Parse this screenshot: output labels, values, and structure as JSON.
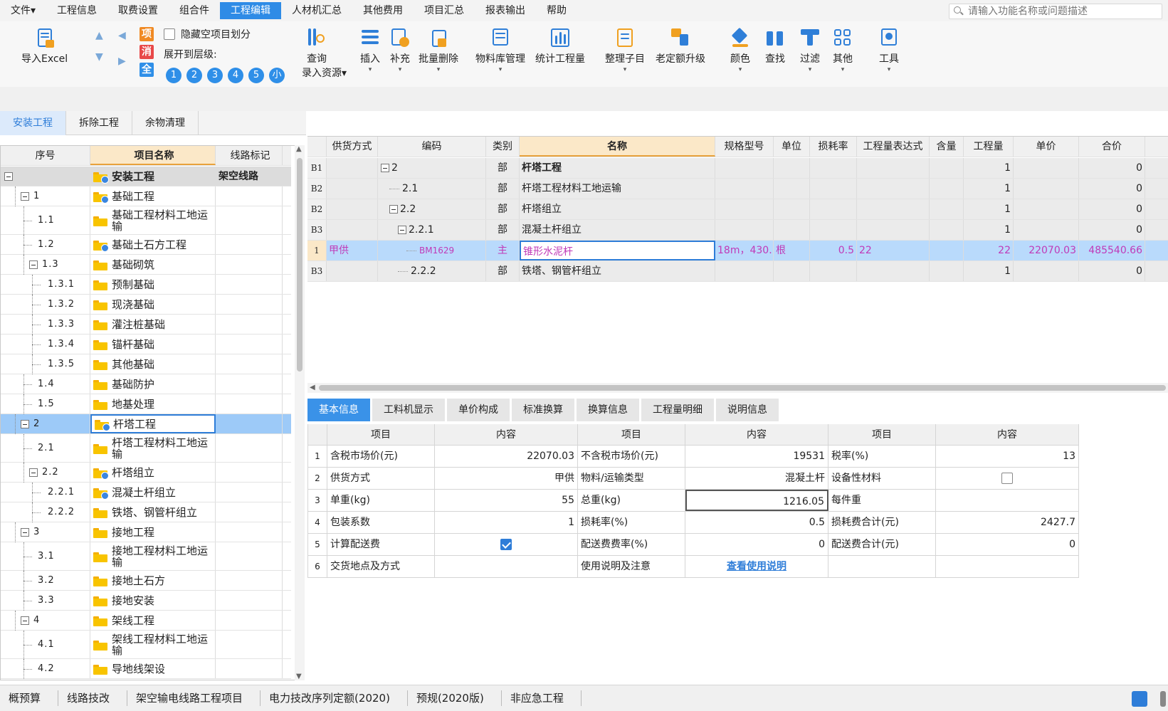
{
  "menu": {
    "items": [
      "文件▾",
      "工程信息",
      "取费设置",
      "组合件",
      "工程编辑",
      "人材机汇总",
      "其他费用",
      "项目汇总",
      "报表输出",
      "帮助"
    ],
    "active_index": 4,
    "search_placeholder": "请输入功能名称或问题描述"
  },
  "ribbon": {
    "import_excel": "导入Excel",
    "hide_empty": "隐藏空项目划分",
    "expand_to": "展开到层级:",
    "badges": {
      "xiang": "项",
      "xiao": "消",
      "quan": "全"
    },
    "levels": [
      "1",
      "2",
      "3",
      "4",
      "5",
      "小"
    ],
    "query": "查询",
    "entry_resource": "录入资源▾",
    "insert": "插入",
    "supplement": "补充",
    "batch_delete": "批量删除",
    "material_lib": "物料库管理",
    "stat_quantity": "统计工程量",
    "organize": "整理子目",
    "upgrade": "老定额升级",
    "color": "颜色",
    "find": "查找",
    "filter": "过滤",
    "other": "其他",
    "tools": "工具"
  },
  "left_tabs": [
    "安装工程",
    "拆除工程",
    "余物清理"
  ],
  "left_tree": {
    "headers": {
      "seq": "序号",
      "name": "项目名称",
      "mark": "线路标记"
    },
    "rows": [
      {
        "seq": "",
        "name": "安装工程",
        "mark": "架空线路",
        "icon": "folder-checked-icon"
      },
      {
        "seq": "1",
        "name": "基础工程",
        "mark": "",
        "icon": "folder-checked-icon"
      },
      {
        "seq": "1.1",
        "name": "基础工程材料工地运输",
        "mark": "",
        "icon": "folder-icon"
      },
      {
        "seq": "1.2",
        "name": "基础土石方工程",
        "mark": "",
        "icon": "folder-checked-icon"
      },
      {
        "seq": "1.3",
        "name": "基础砌筑",
        "mark": "",
        "icon": "folder-icon"
      },
      {
        "seq": "1.3.1",
        "name": "预制基础",
        "mark": "",
        "icon": "folder-icon"
      },
      {
        "seq": "1.3.2",
        "name": "现浇基础",
        "mark": "",
        "icon": "folder-icon"
      },
      {
        "seq": "1.3.3",
        "name": "灌注桩基础",
        "mark": "",
        "icon": "folder-icon"
      },
      {
        "seq": "1.3.4",
        "name": "锚杆基础",
        "mark": "",
        "icon": "folder-icon"
      },
      {
        "seq": "1.3.5",
        "name": "其他基础",
        "mark": "",
        "icon": "folder-icon"
      },
      {
        "seq": "1.4",
        "name": "基础防护",
        "mark": "",
        "icon": "folder-icon"
      },
      {
        "seq": "1.5",
        "name": "地基处理",
        "mark": "",
        "icon": "folder-icon"
      },
      {
        "seq": "2",
        "name": "杆塔工程",
        "mark": "",
        "icon": "folder-checked-icon"
      },
      {
        "seq": "2.1",
        "name": "杆塔工程材料工地运输",
        "mark": "",
        "icon": "folder-icon"
      },
      {
        "seq": "2.2",
        "name": "杆塔组立",
        "mark": "",
        "icon": "folder-checked-icon"
      },
      {
        "seq": "2.2.1",
        "name": "混凝土杆组立",
        "mark": "",
        "icon": "folder-checked-icon"
      },
      {
        "seq": "2.2.2",
        "name": "铁塔、钢管杆组立",
        "mark": "",
        "icon": "folder-icon"
      },
      {
        "seq": "3",
        "name": "接地工程",
        "mark": "",
        "icon": "folder-icon"
      },
      {
        "seq": "3.1",
        "name": "接地工程材料工地运输",
        "mark": "",
        "icon": "folder-icon"
      },
      {
        "seq": "3.2",
        "name": "接地土石方",
        "mark": "",
        "icon": "folder-icon"
      },
      {
        "seq": "3.3",
        "name": "接地安装",
        "mark": "",
        "icon": "folder-icon"
      },
      {
        "seq": "4",
        "name": "架线工程",
        "mark": "",
        "icon": "folder-icon"
      },
      {
        "seq": "4.1",
        "name": "架线工程材料工地运输",
        "mark": "",
        "icon": "folder-icon"
      },
      {
        "seq": "4.2",
        "name": "导地线架设",
        "mark": "",
        "icon": "folder-icon"
      }
    ]
  },
  "grid": {
    "headers": [
      "",
      "供货方式",
      "编码",
      "类别",
      "名称",
      "规格型号",
      "单位",
      "损耗率",
      "工程量表达式",
      "含量",
      "工程量",
      "单价",
      "合价"
    ],
    "rows": [
      {
        "id": "B1",
        "supply": "",
        "code": "2",
        "type": "部",
        "name": "杆塔工程",
        "spec": "",
        "unit": "",
        "loss": "",
        "expr": "",
        "content": "",
        "qty": "1",
        "price": "",
        "total": "0"
      },
      {
        "id": "B2",
        "supply": "",
        "code": "2.1",
        "type": "部",
        "name": "杆塔工程材料工地运输",
        "spec": "",
        "unit": "",
        "loss": "",
        "expr": "",
        "content": "",
        "qty": "1",
        "price": "",
        "total": "0"
      },
      {
        "id": "B2",
        "supply": "",
        "code": "2.2",
        "type": "部",
        "name": "杆塔组立",
        "spec": "",
        "unit": "",
        "loss": "",
        "expr": "",
        "content": "",
        "qty": "1",
        "price": "",
        "total": "0"
      },
      {
        "id": "B3",
        "supply": "",
        "code": "2.2.1",
        "type": "部",
        "name": "混凝土杆组立",
        "spec": "",
        "unit": "",
        "loss": "",
        "expr": "",
        "content": "",
        "qty": "1",
        "price": "",
        "total": "0"
      },
      {
        "id": "1",
        "supply": "甲供",
        "code": "BM1629",
        "type": "主",
        "name": "锥形水泥杆",
        "spec": "18m，430…",
        "unit": "根",
        "loss": "0.5",
        "expr": "22",
        "content": "",
        "qty": "22",
        "price": "22070.03",
        "total": "485540.66"
      },
      {
        "id": "B3",
        "supply": "",
        "code": "2.2.2",
        "type": "部",
        "name": "铁塔、钢管杆组立",
        "spec": "",
        "unit": "",
        "loss": "",
        "expr": "",
        "content": "",
        "qty": "1",
        "price": "",
        "total": "0"
      }
    ]
  },
  "bottom_tabs": [
    "基本信息",
    "工料机显示",
    "单价构成",
    "标准换算",
    "换算信息",
    "工程量明细",
    "说明信息"
  ],
  "detail": {
    "headers": [
      "",
      "项目",
      "内容",
      "项目",
      "内容",
      "项目",
      "内容"
    ],
    "rows": [
      {
        "idx": "1",
        "k1": "含税市场价(元)",
        "v1": "22070.03",
        "k2": "不含税市场价(元)",
        "v2": "19531",
        "k3": "税率(%)",
        "v3": "13"
      },
      {
        "idx": "2",
        "k1": "供货方式",
        "v1": "甲供",
        "k2": "物料/运输类型",
        "v2": "混凝土杆",
        "k3": "设备性材料",
        "v3": ""
      },
      {
        "idx": "3",
        "k1": "单重(kg)",
        "v1": "55",
        "k2": "总重(kg)",
        "v2": "1216.05",
        "k3": "每件重",
        "v3": ""
      },
      {
        "idx": "4",
        "k1": "包装系数",
        "v1": "1",
        "k2": "损耗率(%)",
        "v2": "0.5",
        "k3": "损耗费合计(元)",
        "v3": "2427.7"
      },
      {
        "idx": "5",
        "k1": "计算配送费",
        "v1": "",
        "k2": "配送费费率(%)",
        "v2": "0",
        "k3": "配送费合计(元)",
        "v3": "0"
      },
      {
        "idx": "6",
        "k1": "交货地点及方式",
        "v1": "",
        "k2": "使用说明及注意",
        "v2": "查看使用说明",
        "k3": "",
        "v3": ""
      }
    ]
  },
  "status": {
    "items": [
      "概预算",
      "线路技改",
      "架空输电线路工程项目",
      "电力技改序列定额(2020)",
      "预规(2020版)",
      "非应急工程"
    ]
  }
}
